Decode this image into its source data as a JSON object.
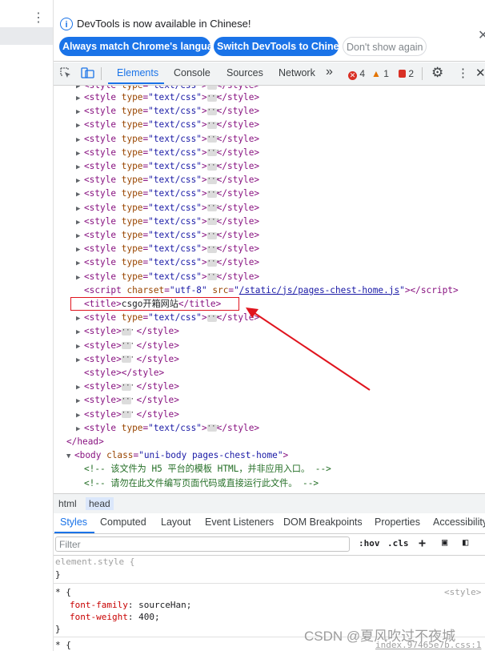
{
  "infobar": {
    "message": "DevTools is now available in Chinese!",
    "btn_match": "Always match Chrome's language",
    "btn_switch": "Switch DevTools to Chinese",
    "btn_dont_show": "Don't show again"
  },
  "toolbar": {
    "tabs": [
      "Elements",
      "Console",
      "Sources",
      "Network"
    ],
    "more": "»",
    "errors": "4",
    "warnings": "1",
    "issues": "2"
  },
  "dom_lines": [
    {
      "kind": "style_collapsed",
      "type": "text/css"
    },
    {
      "kind": "style_collapsed",
      "type": "text/css"
    },
    {
      "kind": "style_collapsed",
      "type": "text/css"
    },
    {
      "kind": "style_collapsed",
      "type": "text/css"
    },
    {
      "kind": "style_collapsed",
      "type": "text/css"
    },
    {
      "kind": "style_collapsed",
      "type": "text/css"
    },
    {
      "kind": "style_collapsed",
      "type": "text/css"
    },
    {
      "kind": "style_collapsed",
      "type": "text/css"
    },
    {
      "kind": "style_collapsed",
      "type": "text/css"
    },
    {
      "kind": "style_collapsed",
      "type": "text/css"
    },
    {
      "kind": "style_collapsed",
      "type": "text/css"
    },
    {
      "kind": "style_collapsed",
      "type": "text/css"
    },
    {
      "kind": "style_collapsed",
      "type": "text/css"
    },
    {
      "kind": "style_collapsed",
      "type": "text/css"
    }
  ],
  "script_line": {
    "charset": "utf-8",
    "src": "/static/js/pages-chest-home.js"
  },
  "title_text": "csgo开箱网站",
  "after_title": [
    {
      "kind": "style_collapsed",
      "type": "text/css"
    },
    {
      "kind": "style_plain"
    },
    {
      "kind": "style_plain"
    },
    {
      "kind": "style_plain"
    },
    {
      "kind": "style_empty"
    },
    {
      "kind": "style_plain"
    },
    {
      "kind": "style_plain"
    },
    {
      "kind": "style_plain"
    },
    {
      "kind": "style_collapsed",
      "type": "text/css"
    }
  ],
  "body_class": "uni-body pages-chest-home",
  "comment1": "<!-- 该文件为 H5 平台的模板 HTML，并非应用入口。 -->",
  "comment2": "<!-- 请勿在此文件编写页面代码或直接运行此文件。 -->",
  "breadcrumbs": [
    "html",
    "head"
  ],
  "subtabs": [
    "Styles",
    "Computed",
    "Layout",
    "Event Listeners",
    "DOM Breakpoints",
    "Properties",
    "Accessibility"
  ],
  "filter": {
    "placeholder": "Filter",
    "hov": ":hov",
    "cls": ".cls"
  },
  "styles": {
    "element_style": "element.style {",
    "close": "}",
    "universal": "* {",
    "source1": "<style>",
    "decl1_prop": "font-family",
    "decl1_val": "sourceHan;",
    "decl2_prop": "font-weight",
    "decl2_val": "400;",
    "universal2": "* {",
    "source2": "index.97465e7b.css:1"
  },
  "watermark": "CSDN @夏风吹过不夜城",
  "colors": {
    "accent": "#1a73e8",
    "tag": "#881280",
    "attr_name": "#994500",
    "attr_value": "#1a1aa6",
    "highlight": "#e0141e"
  }
}
